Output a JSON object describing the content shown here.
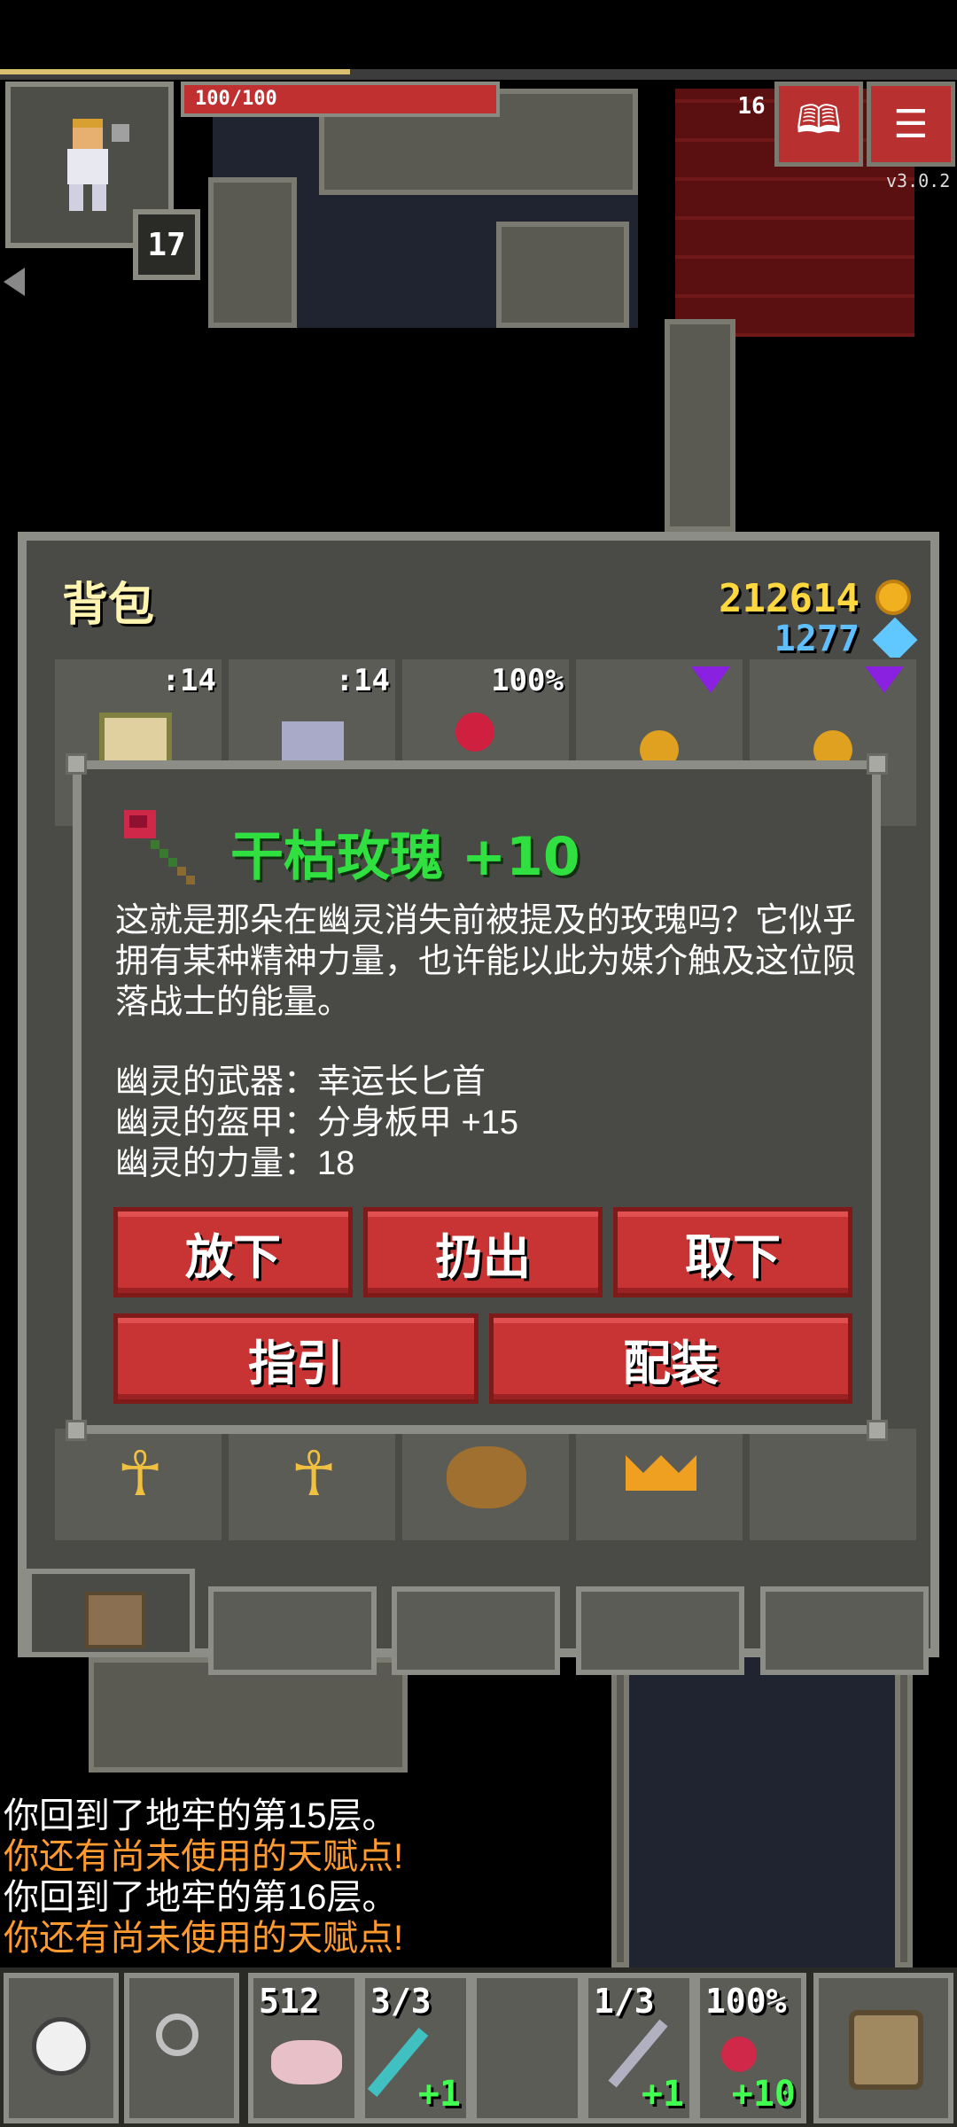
{
  "hud": {
    "hp_text": "100/100",
    "hp_fraction": 1.0,
    "level": "17",
    "depth": "16",
    "version": "v3.0.2",
    "journal_icon": "book-icon",
    "menu_icon": "menu-icon"
  },
  "bag": {
    "title": "背包",
    "gold": "212614",
    "gems": "1277",
    "row1_tags": [
      ":14",
      ":14",
      "100%",
      "",
      ""
    ]
  },
  "item": {
    "name": "干枯玫瑰 +10",
    "description": "这就是那朵在幽灵消失前被提及的玫瑰吗？它似乎拥有某种精神力量，也许能以此为媒介触及这位陨落战士的能量。",
    "stats": [
      "幽灵的武器：幸运长匕首",
      "幽灵的盔甲：分身板甲 +15",
      "幽灵的力量：18"
    ],
    "buttons": {
      "drop": "放下",
      "throw": "扔出",
      "unequip": "取下",
      "guide": "指引",
      "equip": "配装"
    }
  },
  "log": [
    {
      "text": "你回到了地牢的第15层。",
      "color": "#ffffff"
    },
    {
      "text": "你还有尚未使用的天赋点!",
      "color": "#ff9a30"
    },
    {
      "text": "你回到了地牢的第16层。",
      "color": "#ffffff"
    },
    {
      "text": "你还有尚未使用的天赋点!",
      "color": "#ff9a30"
    }
  ],
  "toolbar": {
    "slots": [
      {
        "top": "512",
        "bottom": ""
      },
      {
        "top": "3/3",
        "bottom": "+1"
      },
      {
        "top": "",
        "bottom": ""
      },
      {
        "top": "1/3",
        "bottom": "+1"
      },
      {
        "top": "100%",
        "bottom": "+10"
      }
    ]
  }
}
